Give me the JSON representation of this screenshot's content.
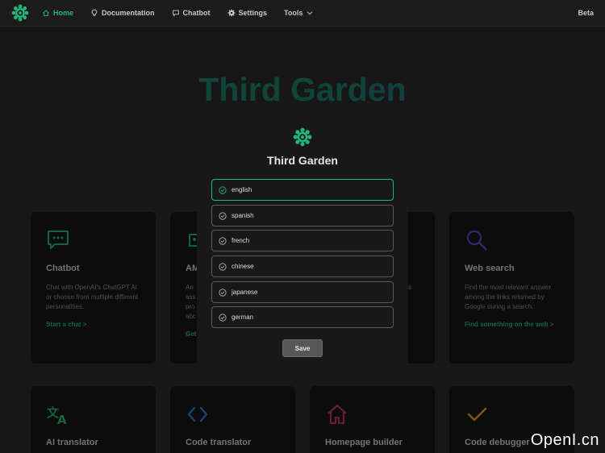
{
  "nav": {
    "items": [
      {
        "label": "Home",
        "icon": "home-icon",
        "active": true
      },
      {
        "label": "Documentation",
        "icon": "lightbulb-icon",
        "active": false
      },
      {
        "label": "Chatbot",
        "icon": "chat-bubble-icon",
        "active": false
      },
      {
        "label": "Settings",
        "icon": "gear-icon",
        "active": false
      },
      {
        "label": "Tools",
        "icon": "chevron-down-icon",
        "active": false
      }
    ],
    "beta": "Beta"
  },
  "hero": {
    "title": "Third Garden"
  },
  "cards": [
    {
      "title": "Chatbot",
      "desc": "Chat with OpenAI's ChatGPT AI or choose from multiple different personalities.",
      "link": "Start a chat >",
      "icon": "chat-icon",
      "color": "#23b47a"
    },
    {
      "title": "AM",
      "desc": "An ass pro abc",
      "link": "Get",
      "icon": "robot-icon",
      "color": "#23b47a"
    },
    {
      "title": "",
      "desc": "s",
      "link": "",
      "icon": "",
      "color": ""
    },
    {
      "title": "Web search",
      "desc": "Find the most relevant answer among the links returned by Google during a search.",
      "link": "Find something on the web >",
      "icon": "search-icon",
      "color": "#5a4fcf"
    },
    {
      "title": "AI translator",
      "icon": "translate-icon",
      "color": "#23b47a"
    },
    {
      "title": "Code translator",
      "icon": "code-icon",
      "color": "#2a7fd4"
    },
    {
      "title": "Homepage builder",
      "icon": "home-icon",
      "color": "#c0306a"
    },
    {
      "title": "Code debugger",
      "icon": "check-icon",
      "color": "#d4a020"
    }
  ],
  "modal": {
    "title": "Third Garden",
    "languages": [
      "english",
      "spanish",
      "french",
      "chinese",
      "japanese",
      "german"
    ],
    "selected": "english",
    "save_label": "Save"
  },
  "watermark": "OpenI.cn",
  "colors": {
    "accent": "#23b47a",
    "background": "#2a2a2a",
    "navbar": "#1b1b1b",
    "card": "#161616"
  }
}
